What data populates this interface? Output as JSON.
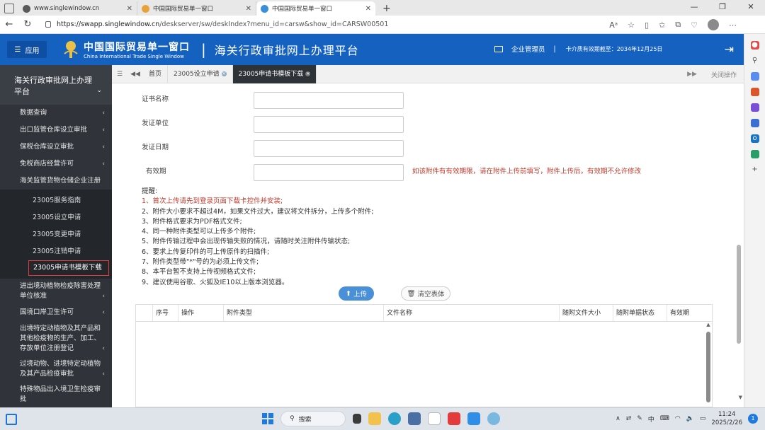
{
  "browser": {
    "tabs": [
      {
        "title": "www.singlewindow.cn",
        "active": false,
        "color": "#5a5a5a"
      },
      {
        "title": "中国国际贸易单一窗口",
        "active": false,
        "color": "#e8a23a"
      },
      {
        "title": "中国国际贸易单一窗口",
        "active": true,
        "color": "#3a8fd9"
      }
    ],
    "url_host": "https://swapp.singlewindow.cn",
    "url_path": "/deskserver/sw/deskIndex?menu_id=carsw&show_id=CARSW00501"
  },
  "header": {
    "apps_label": "应用",
    "logo_cn": "中国国际贸易单一窗口",
    "logo_en": "China International Trade Single Window",
    "platform_title": "海关行政审批网上办理平台",
    "user_label": "企业管理员",
    "validity": "卡介质有效期截至：2034年12月25日"
  },
  "leftnav": {
    "title": "海关行政审批网上办理平台",
    "items_before": [
      "数据查询",
      "出口监管仓库设立审批",
      "保税仓库设立审批",
      "免税商店经营许可",
      "海关监管货物仓储企业注册"
    ],
    "subitems": [
      "23005服务指南",
      "23005设立申请",
      "23005变更申请",
      "23005注销申请",
      "23005申请书模板下载"
    ],
    "items_after": [
      "进出境动植物检疫除害处理单位核准",
      "国境口岸卫生许可",
      "出境特定动植物及其产品和其他检疫物的生产、加工、存放单位注册登记",
      "过境动物、进境特定动植物及其产品检疫审批",
      "特殊物品出入境卫生检疫审批"
    ]
  },
  "content_tabs": {
    "home": "首页",
    "tabs": [
      "23005设立申请",
      "23005申请书模板下载"
    ],
    "close_ops": "关闭操作"
  },
  "form": {
    "fields": [
      "证书名称",
      "发证单位",
      "发证日期",
      "有效期"
    ],
    "validity_hint": "如该附件有有效期限，请在附件上传前填写，附件上传后，有效期不允许修改"
  },
  "tips": {
    "title": "提醒:",
    "lines": [
      "1、首次上传请先到登录页面下载卡控件并安装;",
      "2、附件大小要求不超过4M，如果文件过大，建议将文件拆分，上传多个附件;",
      "3、附件格式要求为PDF格式文件;",
      "4、同一种附件类型可以上传多个附件;",
      "5、附件传输过程中会出现传输失败的情况，请随时关注附件传输状态;",
      "6、要求上传复印件的可上传原件的扫描件;",
      "7、附件类型带\"*\"号的为必须上传文件;",
      "8、本平台暂不支持上传视频格式文件;",
      "9、建议使用谷歌、火狐及IE10以上版本浏览器。"
    ]
  },
  "buttons": {
    "upload": "上传",
    "clear": "清空表体"
  },
  "grid": {
    "columns": [
      "序号",
      "操作",
      "附件类型",
      "文件名称",
      "随附文件大小",
      "随附单据状态",
      "有效期"
    ]
  },
  "taskbar": {
    "search": "搜索",
    "ime": "中",
    "time": "11:24",
    "date": "2025/2/26",
    "notifications": "1"
  }
}
